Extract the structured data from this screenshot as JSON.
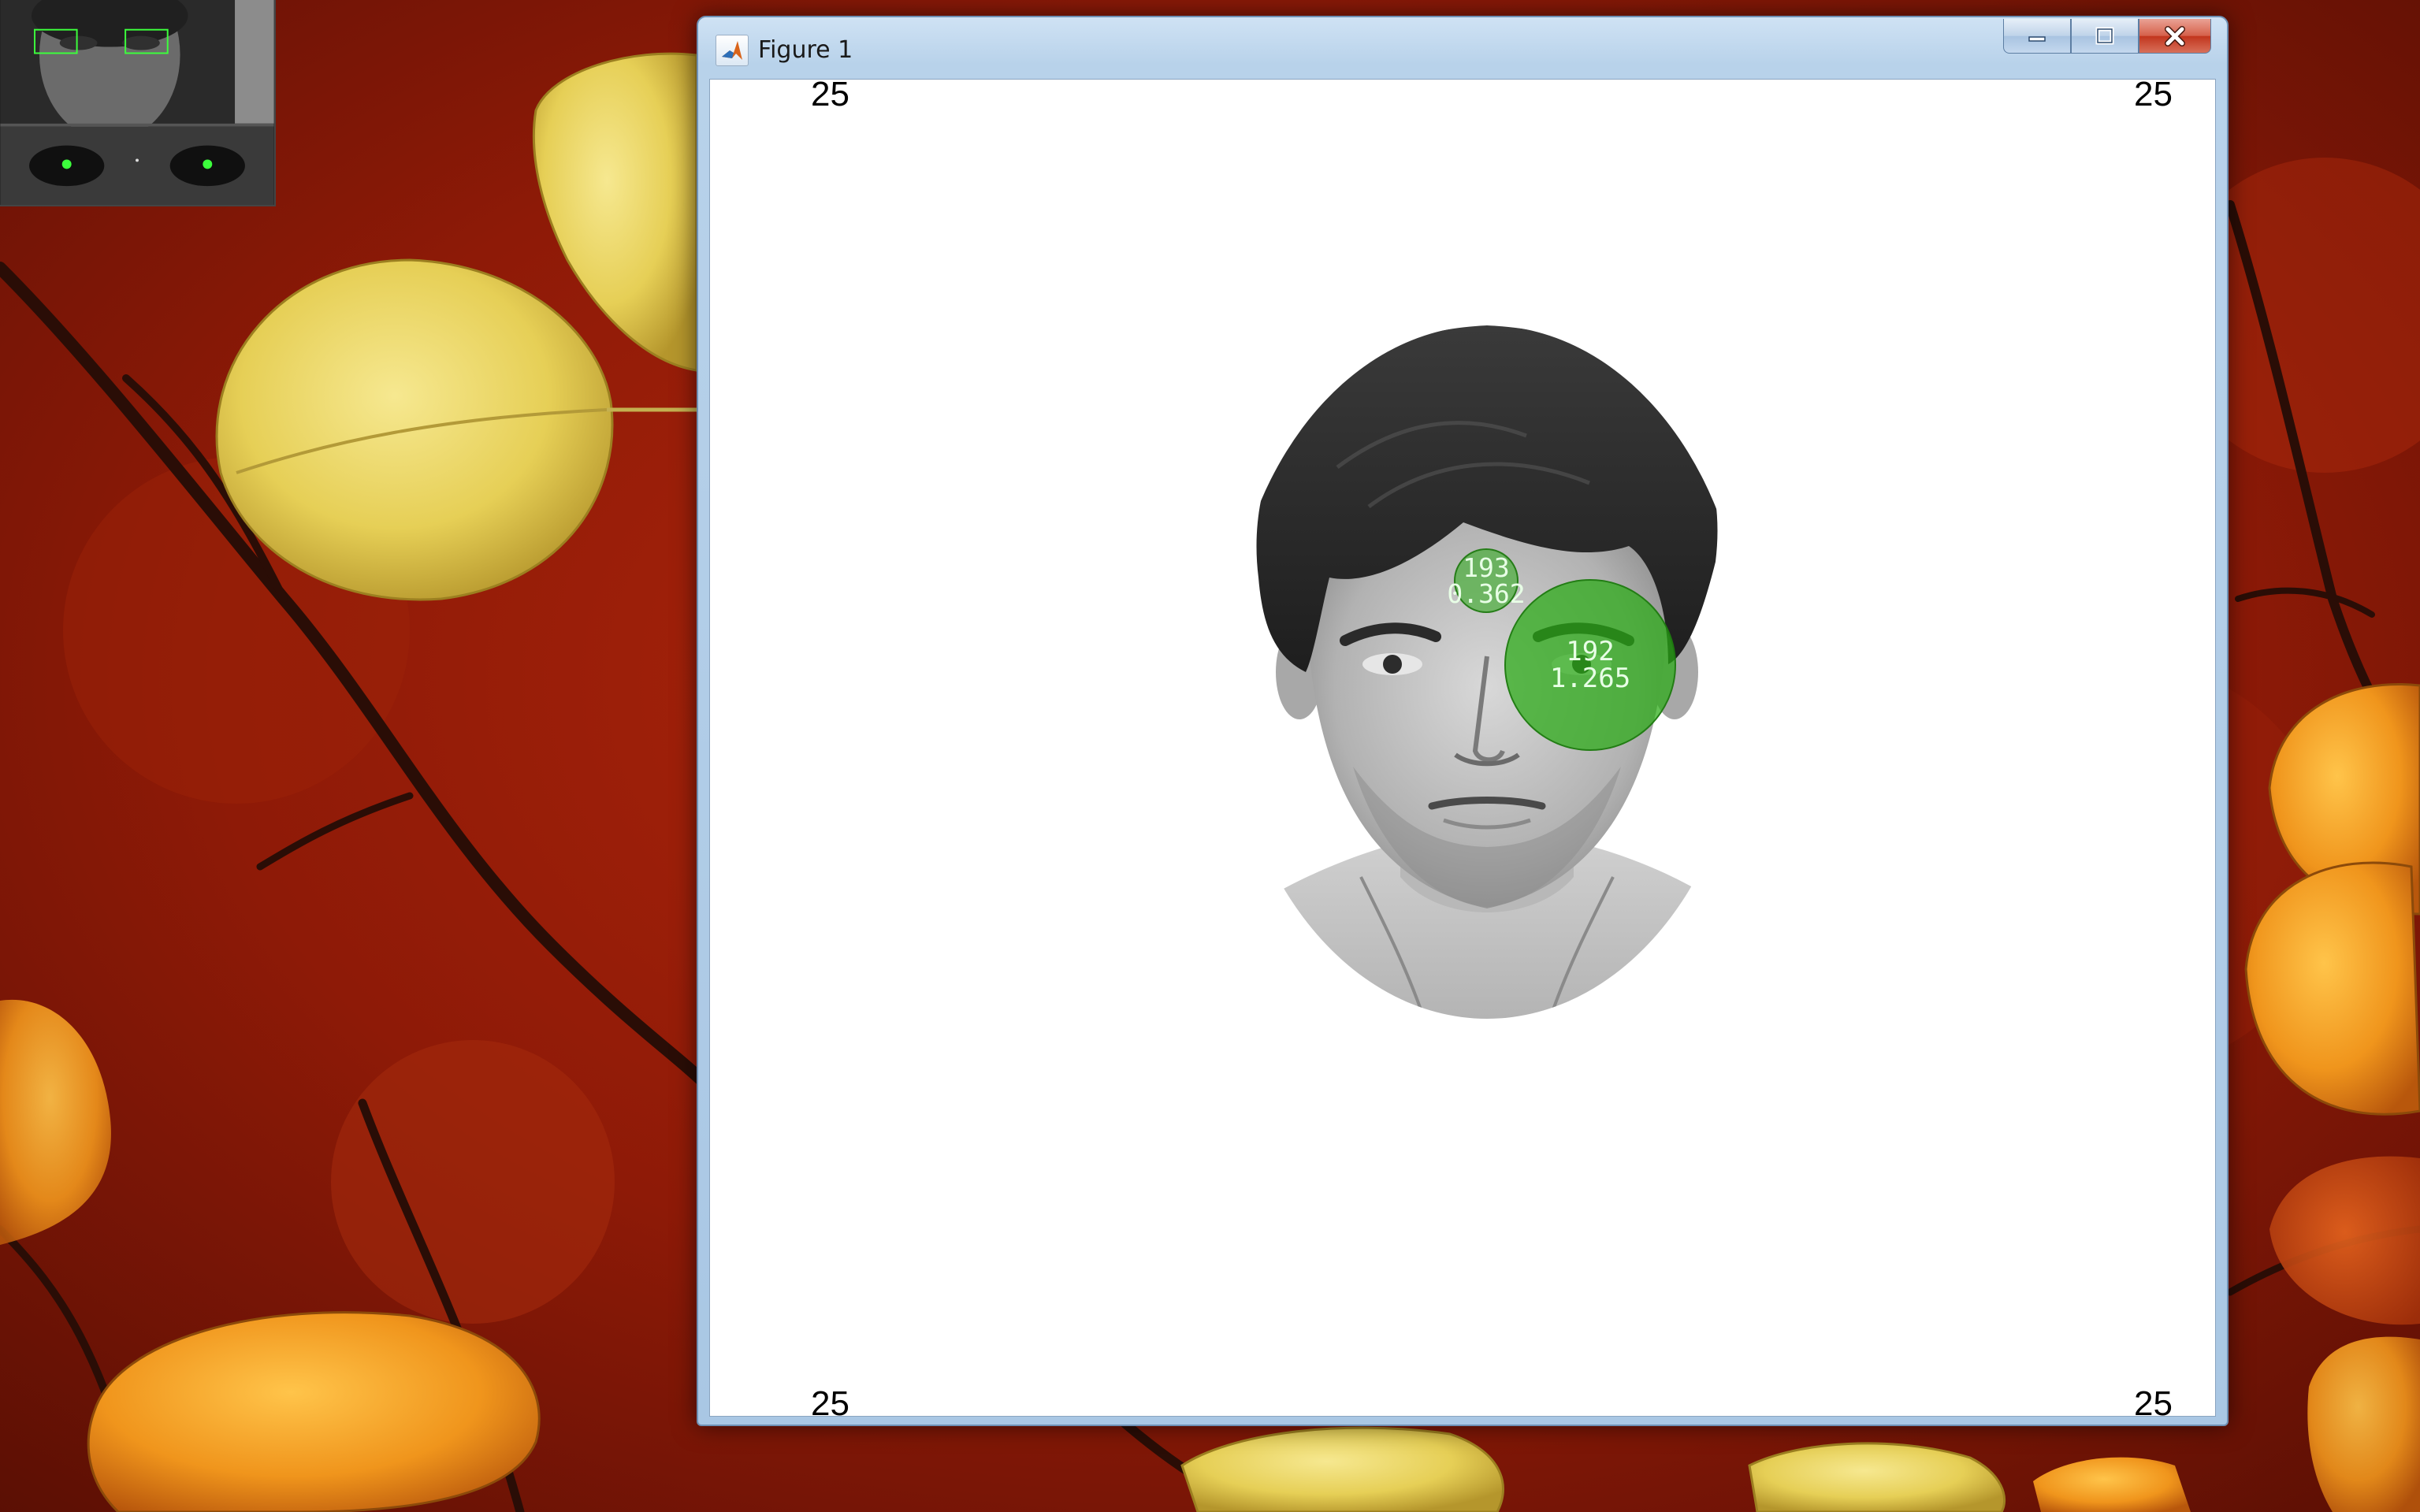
{
  "window": {
    "title": "Figure 1",
    "app_icon": "matlab-icon",
    "buttons": {
      "minimize": "minimize-icon",
      "maximize": "maximize-icon",
      "close": "close-icon"
    }
  },
  "figure": {
    "corner_labels": {
      "top_left": "25",
      "top_right": "25",
      "bottom_left": "25",
      "bottom_right": "25"
    },
    "fixations": [
      {
        "id": "193",
        "duration": "0.362"
      },
      {
        "id": "192",
        "duration": "1.265"
      }
    ],
    "fixation_color": "#2aaa14"
  },
  "camera_preview": {
    "accent": "#3cff3c"
  },
  "desktop": {
    "wallpaper": "autumn-leaves",
    "colors": [
      "#8b1a08",
      "#e8c84a",
      "#f0a020"
    ]
  }
}
